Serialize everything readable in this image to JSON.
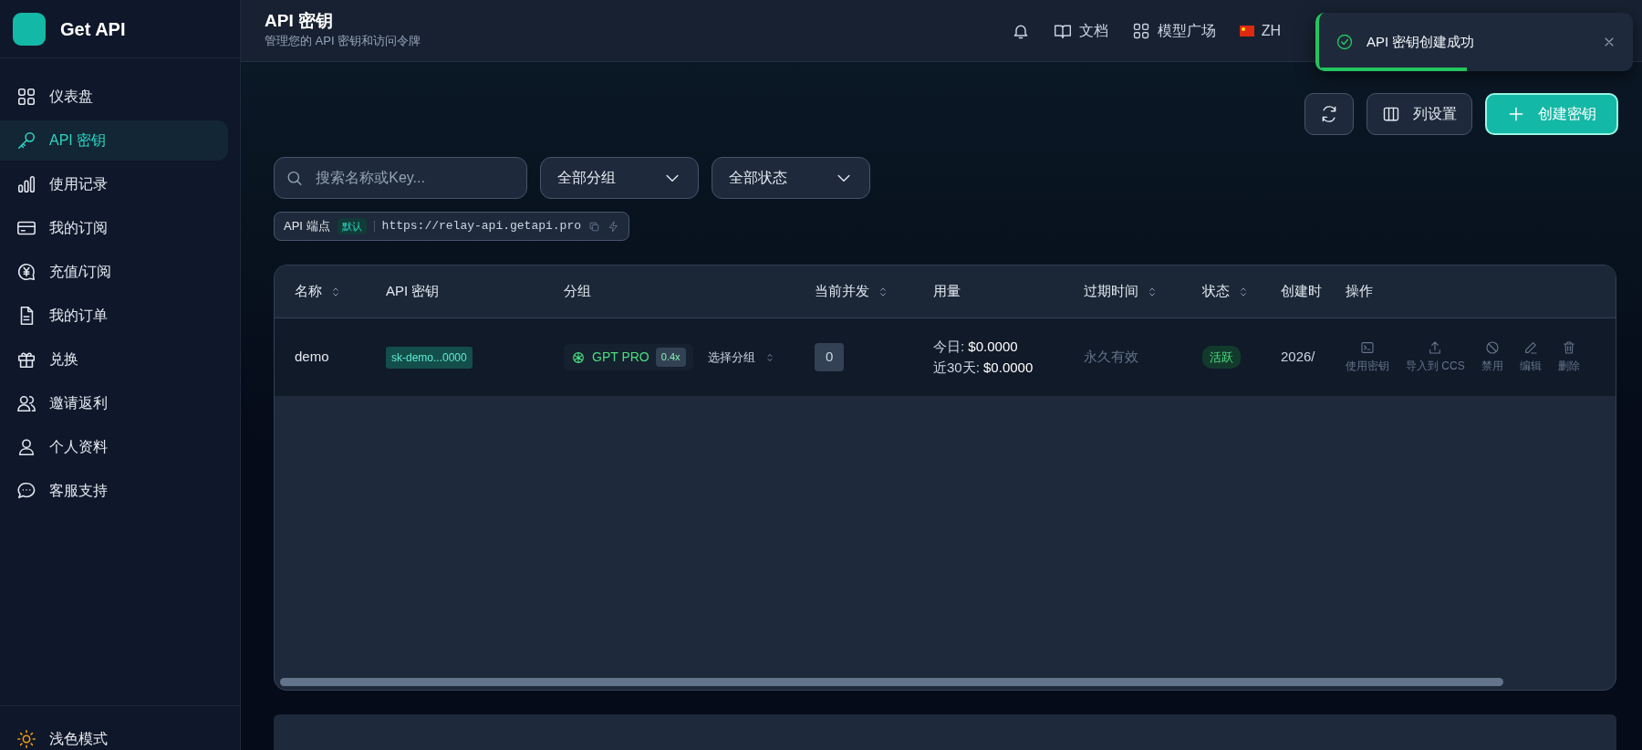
{
  "brand": {
    "name": "Get API"
  },
  "sidebar": {
    "items": [
      {
        "label": "仪表盘",
        "selected": false
      },
      {
        "label": "API 密钥",
        "selected": true
      },
      {
        "label": "使用记录",
        "selected": false
      },
      {
        "label": "我的订阅",
        "selected": false
      },
      {
        "label": "充值/订阅",
        "selected": false
      },
      {
        "label": "我的订单",
        "selected": false
      },
      {
        "label": "兑换",
        "selected": false
      },
      {
        "label": "邀请返利",
        "selected": false
      },
      {
        "label": "个人资料",
        "selected": false
      },
      {
        "label": "客服支持",
        "selected": false
      }
    ],
    "theme_toggle": {
      "label": "浅色模式"
    }
  },
  "header": {
    "title": "API 密钥",
    "subtitle": "管理您的 API 密钥和访问令牌",
    "links": [
      {
        "kind": "icon"
      },
      {
        "kind": "link",
        "label": "文档"
      },
      {
        "kind": "link",
        "label": "模型广场"
      },
      {
        "kind": "link",
        "label": "ZH"
      }
    ]
  },
  "toast": {
    "message": "API 密钥创建成功",
    "level": 0.47
  },
  "actions": [
    {
      "kind": "icon"
    },
    {
      "kind": "outline",
      "label": "列设置"
    },
    {
      "kind": "primary",
      "label": "创建密钥"
    }
  ],
  "filters": {
    "search": {
      "placeholder": "搜索名称或Key..."
    },
    "selects": [
      "全部分组",
      "全部状态"
    ]
  },
  "endpoint": {
    "label": "API 端点",
    "tag": "默认",
    "url": "https://relay-api.getapi.pro"
  },
  "table": {
    "columns": [
      {
        "label": "名称",
        "sortable": true
      },
      {
        "label": "API 密钥",
        "sortable": false
      },
      {
        "label": "分组",
        "sortable": false
      },
      {
        "label": "当前并发",
        "sortable": true
      },
      {
        "label": "用量",
        "sortable": false
      },
      {
        "label": "过期时间",
        "sortable": true
      },
      {
        "label": "状态",
        "sortable": true
      },
      {
        "label": "创建时"
      },
      {
        "label": "操作",
        "sortable": false
      }
    ],
    "rows": [
      {
        "name": "demo",
        "key": "sk-demo...0000",
        "group": "GPT PRO",
        "rate": "0.4x",
        "group_select": "选择分组",
        "concurrency": "0",
        "usage": [
          {
            "label": "今日:",
            "value": "$0.0000"
          },
          {
            "label": "近30天:",
            "value": "$0.0000"
          }
        ],
        "expiry": "永久有效",
        "status": "活跃",
        "created": "2026/",
        "row_actions": [
          "使用密钥",
          "导入到 CCS",
          "禁用",
          "编辑",
          "删除"
        ]
      }
    ]
  }
}
